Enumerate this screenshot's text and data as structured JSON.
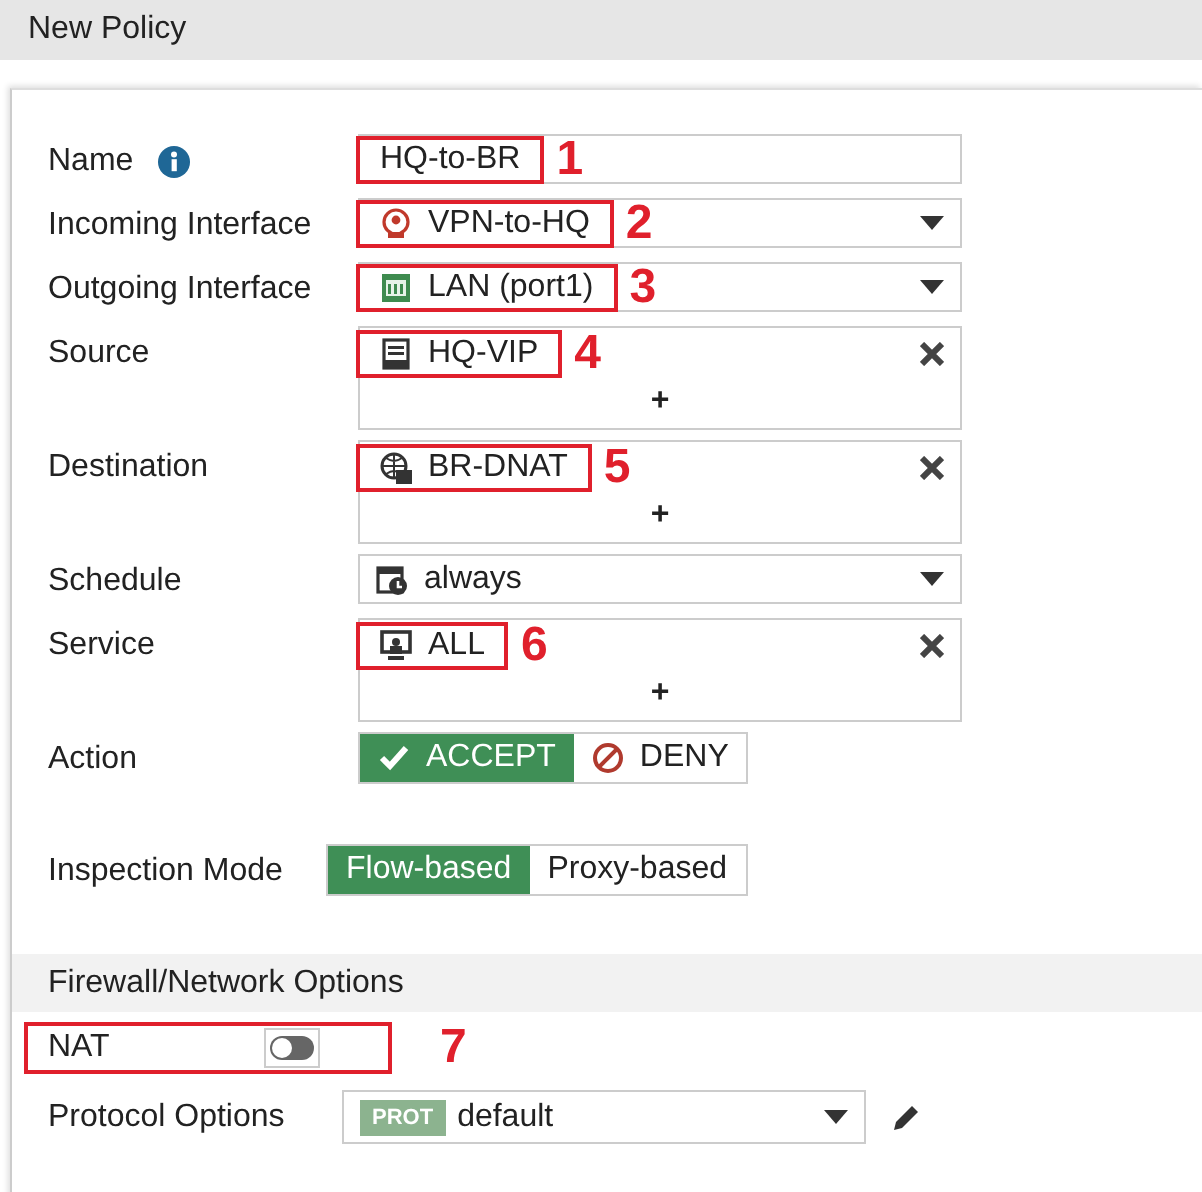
{
  "window": {
    "title": "New Policy"
  },
  "fields": [
    {
      "label": "Name",
      "kind": "text",
      "info": true,
      "value": "HQ-to-BR",
      "marker": "1"
    },
    {
      "label": "Incoming Interface",
      "kind": "select",
      "info": false,
      "value": "VPN-to-HQ",
      "marker": "2"
    },
    {
      "label": "Outgoing Interface",
      "kind": "select",
      "info": false,
      "value": "LAN (port1)",
      "marker": "3"
    },
    {
      "label": "Source",
      "kind": "multi",
      "info": false,
      "value": "HQ-VIP",
      "add": "+",
      "marker": "4"
    },
    {
      "label": "Destination",
      "kind": "multi",
      "info": false,
      "value": "BR-DNAT",
      "add": "+",
      "marker": "5"
    },
    {
      "label": "Schedule",
      "kind": "select",
      "info": false,
      "value": "always"
    },
    {
      "label": "Service",
      "kind": "multi",
      "info": false,
      "value": "ALL",
      "add": "+",
      "marker": "6"
    }
  ],
  "action": {
    "label": "Action",
    "options": [
      {
        "label": "ACCEPT",
        "selected": true
      },
      {
        "label": "DENY",
        "selected": false
      }
    ]
  },
  "inspection": {
    "label": "Inspection Mode",
    "options": [
      {
        "label": "Flow-based",
        "selected": true
      },
      {
        "label": "Proxy-based",
        "selected": false
      }
    ]
  },
  "section": {
    "title": "Firewall/Network Options"
  },
  "nat": {
    "label": "NAT",
    "on": false,
    "marker": "7"
  },
  "protocol": {
    "label": "Protocol Options",
    "badge": "PROT",
    "value": "default"
  }
}
